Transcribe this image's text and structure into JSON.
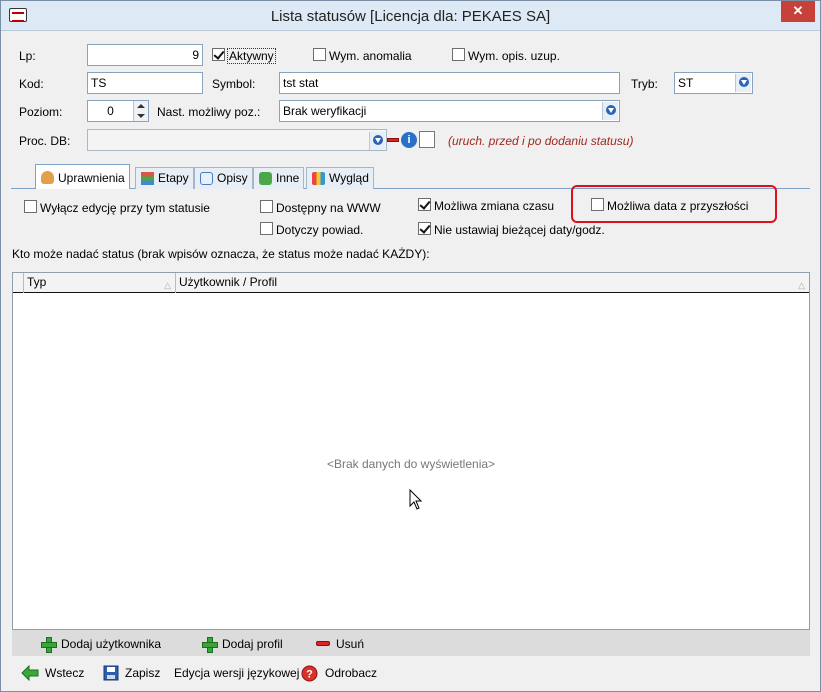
{
  "window": {
    "title": "Lista statusów  [Licencja dla: PEKAES SA]",
    "close": "✕"
  },
  "form": {
    "lp_label": "Lp:",
    "lp_value": "9",
    "aktywny_label": "Aktywny",
    "aktywny_checked": true,
    "wym_anomalia_label": "Wym. anomalia",
    "wym_opis_label": "Wym. opis. uzup.",
    "kod_label": "Kod:",
    "kod_value": "TS",
    "symbol_label": "Symbol:",
    "symbol_value": "tst stat",
    "tryb_label": "Tryb:",
    "tryb_value": "ST",
    "poziom_label": "Poziom:",
    "poziom_value": "0",
    "nast_label": "Nast. możliwy poz.:",
    "nast_value": "Brak weryfikacji",
    "proc_label": "Proc. DB:",
    "proc_value": "",
    "proc_note": "(uruch. przed i po dodaniu statusu)"
  },
  "tabs": [
    {
      "label": "Uprawnienia",
      "icon": "user-icon"
    },
    {
      "label": "Etapy",
      "icon": "stages-icon"
    },
    {
      "label": "Opisy",
      "icon": "comments-icon"
    },
    {
      "label": "Inne",
      "icon": "puzzle-icon"
    },
    {
      "label": "Wygląd",
      "icon": "palette-icon"
    }
  ],
  "options": {
    "wylacz_edycje": "Wyłącz edycję przy tym statusie",
    "dostepny_www": "Dostępny na WWW",
    "dotyczy_powiad": "Dotyczy powiad.",
    "mozliwa_zmiana_czasu": "Możliwa zmiana czasu",
    "nie_ustawiaj": "Nie ustawiaj bieżącej daty/godz.",
    "mozliwa_data": "Możliwa data z przyszłości"
  },
  "grid": {
    "caption": "Kto może nadać status (brak wpisów oznacza, że status może nadać KAŻDY):",
    "columns": [
      "Typ",
      "Użytkownik / Profil"
    ],
    "empty": "<Brak danych do wyświetlenia>"
  },
  "grid_toolbar": {
    "add_user": "Dodaj użytkownika",
    "add_profile": "Dodaj profil",
    "remove": "Usuń"
  },
  "bottom_toolbar": {
    "back": "Wstecz",
    "save": "Zapisz",
    "lang": "Edycja wersji językowej",
    "cancel": "Odrobacz"
  }
}
